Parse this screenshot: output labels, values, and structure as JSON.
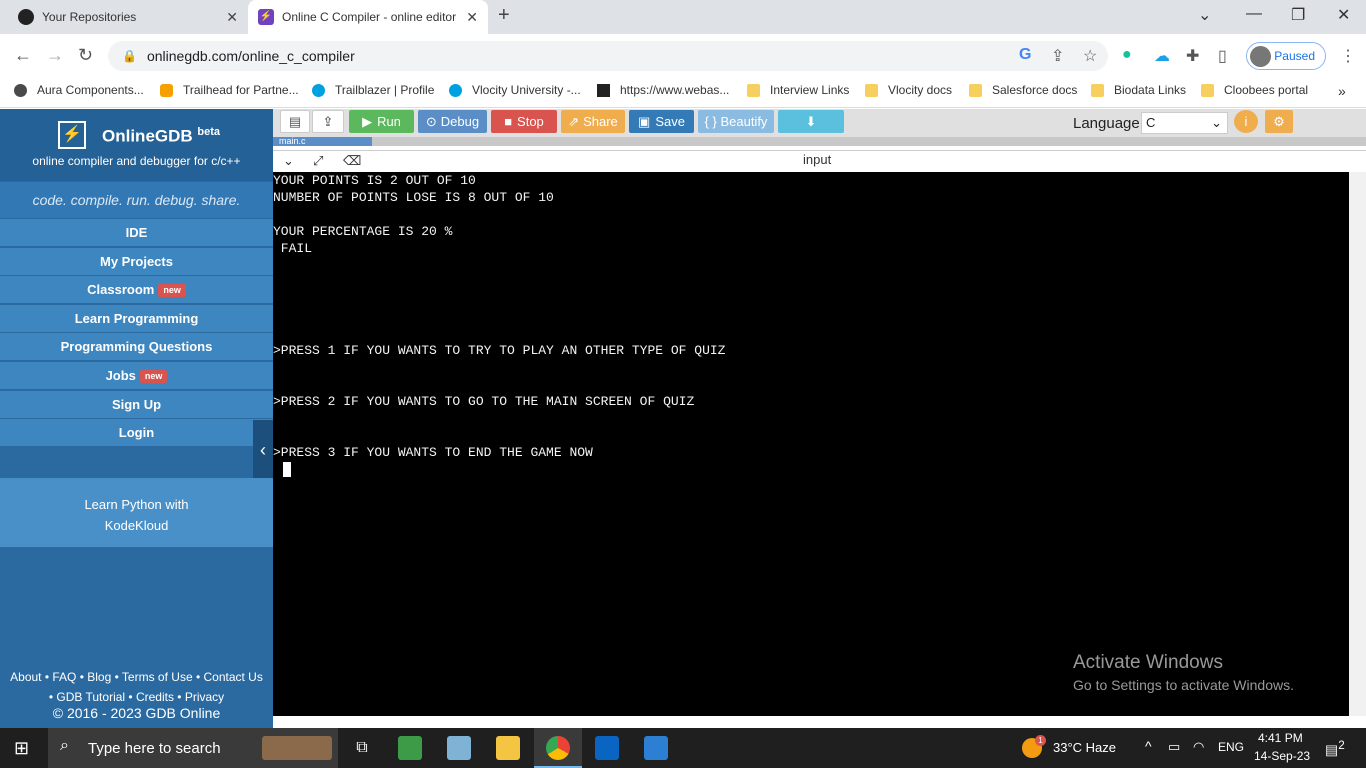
{
  "browser": {
    "tabs": [
      {
        "title": "Your Repositories",
        "icon": "github-icon",
        "active": false
      },
      {
        "title": "Online C Compiler - online editor",
        "icon": "onlinegdb-icon",
        "active": true
      }
    ],
    "url": "onlinegdb.com/online_c_compiler",
    "profile_status": "Paused",
    "bookmarks": [
      {
        "label": "Aura Components...",
        "icon": "aura-icon"
      },
      {
        "label": "Trailhead for Partne...",
        "icon": "trailhead-icon"
      },
      {
        "label": "Trailblazer | Profile",
        "icon": "salesforce-icon"
      },
      {
        "label": "Vlocity University -...",
        "icon": "salesforce-icon"
      },
      {
        "label": "https://www.webas...",
        "icon": "k-icon"
      },
      {
        "label": "Interview Links",
        "icon": "folder-icon"
      },
      {
        "label": "Vlocity docs",
        "icon": "folder-icon"
      },
      {
        "label": "Salesforce docs",
        "icon": "folder-icon"
      },
      {
        "label": "Biodata Links",
        "icon": "folder-icon"
      },
      {
        "label": "Cloobees portal",
        "icon": "folder-icon"
      }
    ]
  },
  "sidebar": {
    "brand": "OnlineGDB",
    "brand_sup": "beta",
    "subtitle": "online compiler and debugger for c/c++",
    "tagline": "code. compile. run. debug. share.",
    "items": [
      {
        "label": "IDE",
        "badge": ""
      },
      {
        "label": "My Projects",
        "badge": ""
      },
      {
        "label": "Classroom",
        "badge": "new"
      },
      {
        "label": "Learn Programming",
        "badge": ""
      },
      {
        "label": "Programming Questions",
        "badge": ""
      },
      {
        "label": "Jobs",
        "badge": "new"
      },
      {
        "label": "Sign Up",
        "badge": ""
      },
      {
        "label": "Login",
        "badge": ""
      }
    ],
    "promo_line1": "Learn Python with",
    "promo_line2": "KodeKloud",
    "footer_line1": "About • FAQ • Blog • Terms of Use • Contact Us",
    "footer_line2": "• GDB Tutorial • Credits • Privacy",
    "copyright": "© 2016 - 2023 GDB Online"
  },
  "toolbar": {
    "run": "Run",
    "debug": "Debug",
    "stop": "Stop",
    "share": "Share",
    "save": "Save",
    "beautify": "{ } Beautify",
    "language_label": "Language",
    "language_value": "C",
    "file_tab": "main.c"
  },
  "io": {
    "input_label": "input"
  },
  "console": {
    "lines": [
      "YOUR POINTS IS 2 OUT OF 10",
      "NUMBER OF POINTS LOSE IS 8 OUT OF 10",
      "YOUR PERCENTAGE IS 20 %",
      " FAIL",
      ">PRESS 1 IF YOU WANTS TO TRY TO PLAY AN OTHER TYPE OF QUIZ",
      ">PRESS 2 IF YOU WANTS TO GO TO THE MAIN SCREEN OF QUIZ",
      ">PRESS 3 IF YOU WANTS TO END THE GAME NOW"
    ]
  },
  "watermark": {
    "line1": "Activate Windows",
    "line2": "Go to Settings to activate Windows."
  },
  "taskbar": {
    "search_placeholder": "Type here to search",
    "weather": "33°C  Haze",
    "weather_badge": "1",
    "lang": "ENG",
    "time": "4:41 PM",
    "date": "14-Sep-23",
    "notifications": "2"
  },
  "colors": {
    "sidebar_bg": "#2b6aa1",
    "run": "#5cb85c",
    "debug": "#5b8ec6",
    "stop": "#d9534f",
    "share": "#f0ad4e",
    "save": "#337ab7",
    "beautify": "#8bbbe0",
    "download": "#5bc0de",
    "console_bg": "#000000"
  }
}
